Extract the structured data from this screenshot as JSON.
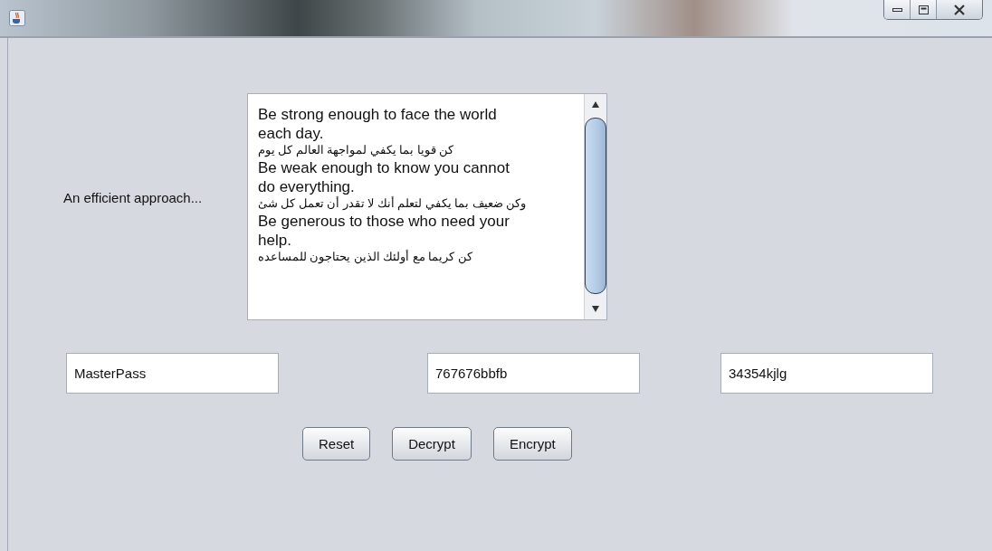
{
  "window": {
    "controls": [
      {
        "kind": "minimize"
      },
      {
        "kind": "maximize"
      },
      {
        "kind": "close"
      }
    ]
  },
  "label": "An efficient approach...",
  "text_area": {
    "paragraphs": [
      {
        "kind": "latin",
        "text": "Be strong enough to face the world\neach day."
      },
      {
        "kind": "arabic",
        "text": "كن قويا بما يكفي لمواجهة العالم كل يوم"
      },
      {
        "kind": "latin",
        "text": "Be weak enough to know you cannot\ndo everything."
      },
      {
        "kind": "arabic",
        "text": "وكن ضعيف بما يكفي لتعلم أنك لا تقدر أن تعمل كل شئ"
      },
      {
        "kind": "latin",
        "text": "Be generous to those who need your\nhelp."
      },
      {
        "kind": "arabic",
        "text": "كن كريما مع أولئك الذين يحتاجون للمساعده"
      }
    ]
  },
  "fields": [
    {
      "value": "MasterPass"
    },
    {
      "value": "767676bbfb"
    },
    {
      "value": "34354kjlg"
    }
  ],
  "buttons": [
    "Reset",
    "Decrypt",
    "Encrypt"
  ]
}
